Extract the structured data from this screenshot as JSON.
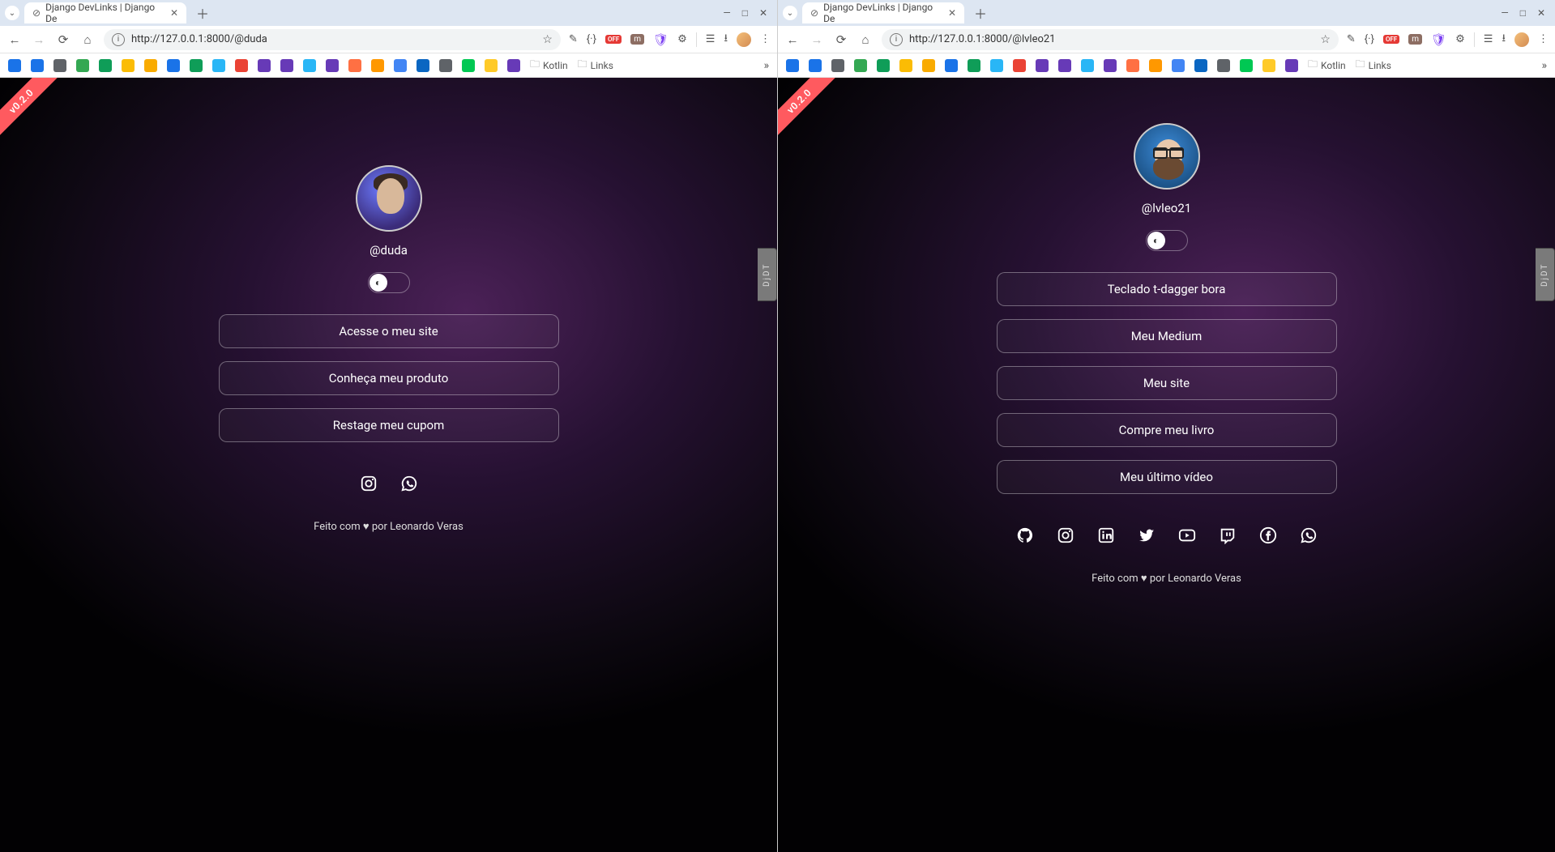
{
  "windows": [
    {
      "tab_title": "Django DevLinks | Django De",
      "url": "http://127.0.0.1:8000/@duda",
      "version_ribbon": "v0.2.0",
      "ddt_label": "DjDT",
      "profile": {
        "handle": "@duda"
      },
      "links": [
        {
          "label": "Acesse o meu site"
        },
        {
          "label": "Conheça meu produto"
        },
        {
          "label": "Restage meu cupom"
        }
      ],
      "socials": [
        {
          "name": "instagram"
        },
        {
          "name": "whatsapp"
        }
      ],
      "footer": "Feito com ♥ por Leonardo Veras",
      "bookmark_folders": [
        "Kotlin",
        "Links"
      ]
    },
    {
      "tab_title": "Django DevLinks | Django De",
      "url": "http://127.0.0.1:8000/@lvleo21",
      "version_ribbon": "v0.2.0",
      "ddt_label": "DjDT",
      "profile": {
        "handle": "@lvleo21"
      },
      "links": [
        {
          "label": "Teclado t-dagger bora"
        },
        {
          "label": "Meu Medium"
        },
        {
          "label": "Meu site"
        },
        {
          "label": "Compre meu livro"
        },
        {
          "label": "Meu último vídeo"
        }
      ],
      "socials": [
        {
          "name": "github"
        },
        {
          "name": "instagram"
        },
        {
          "name": "linkedin"
        },
        {
          "name": "twitter"
        },
        {
          "name": "youtube"
        },
        {
          "name": "twitch"
        },
        {
          "name": "facebook"
        },
        {
          "name": "whatsapp"
        }
      ],
      "footer": "Feito com ♥ por Leonardo Veras",
      "bookmark_folders": [
        "Kotlin",
        "Links"
      ]
    }
  ],
  "bookmark_colors": [
    "#1a73e8",
    "#1a73e8",
    "#5f6368",
    "#34a853",
    "#0f9d58",
    "#fbbc04",
    "#f9ab00",
    "#1a73e8",
    "#0f9d58",
    "#29b6f6",
    "#ea4335",
    "#673ab7",
    "#673ab7",
    "#29b6f6",
    "#673ab7",
    "#ff7043",
    "#ff9800",
    "#4285f4",
    "#0a66c2",
    "#5f6368",
    "#00c853",
    "#ffca28",
    "#673ab7"
  ]
}
